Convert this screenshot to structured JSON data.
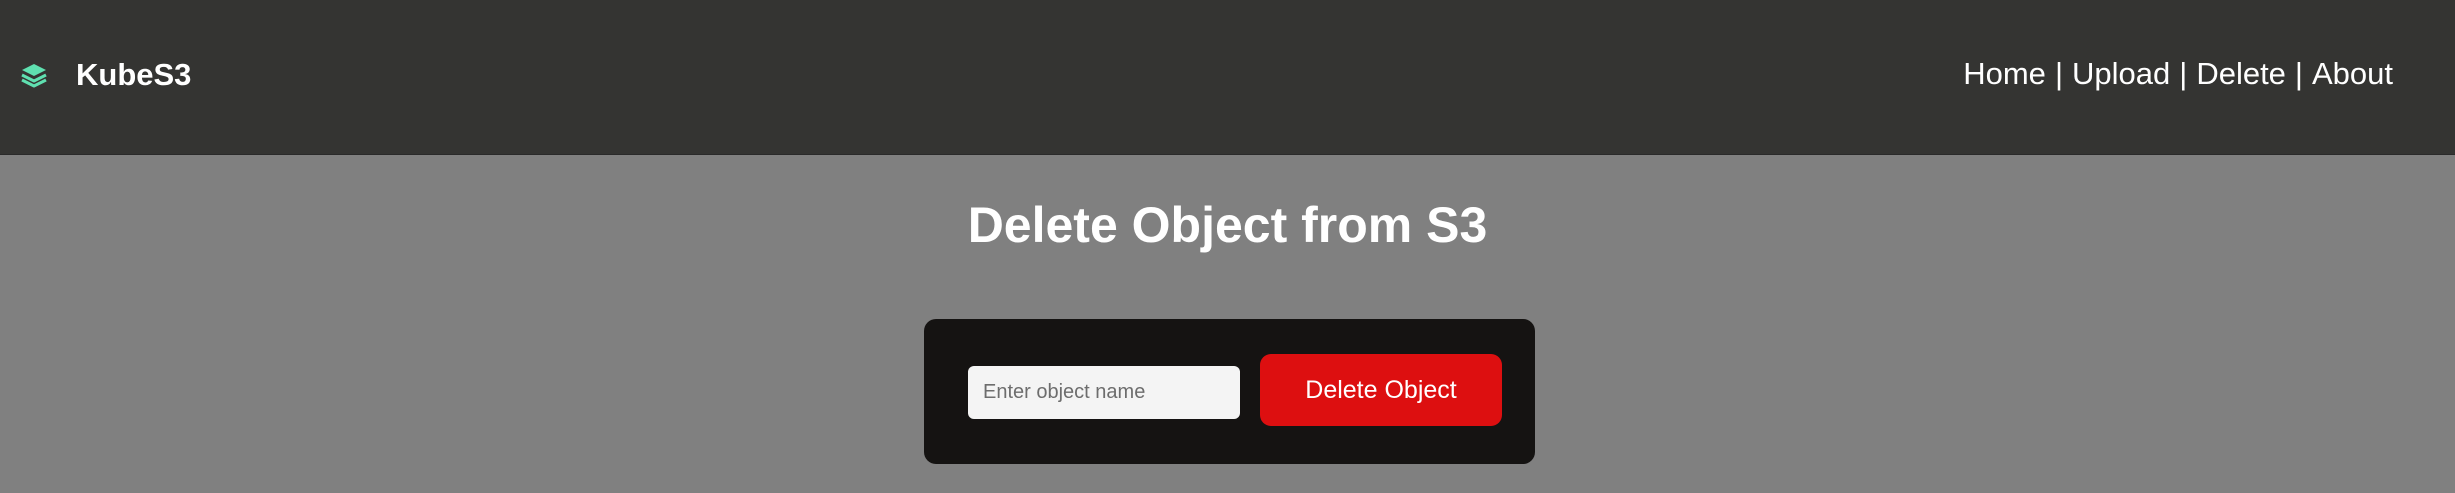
{
  "app": {
    "brand_name": "KubeS3",
    "brand_icon": "layers-icon",
    "accent_color": "#5fe0b0"
  },
  "nav": {
    "links": [
      {
        "label": "Home"
      },
      {
        "label": "Upload"
      },
      {
        "label": "Delete"
      },
      {
        "label": "About"
      }
    ],
    "separator": "|"
  },
  "main": {
    "title": "Delete Object from S3",
    "form": {
      "input_placeholder": "Enter object name",
      "input_value": "",
      "submit_label": "Delete Object",
      "submit_color": "#dd0f10"
    }
  }
}
